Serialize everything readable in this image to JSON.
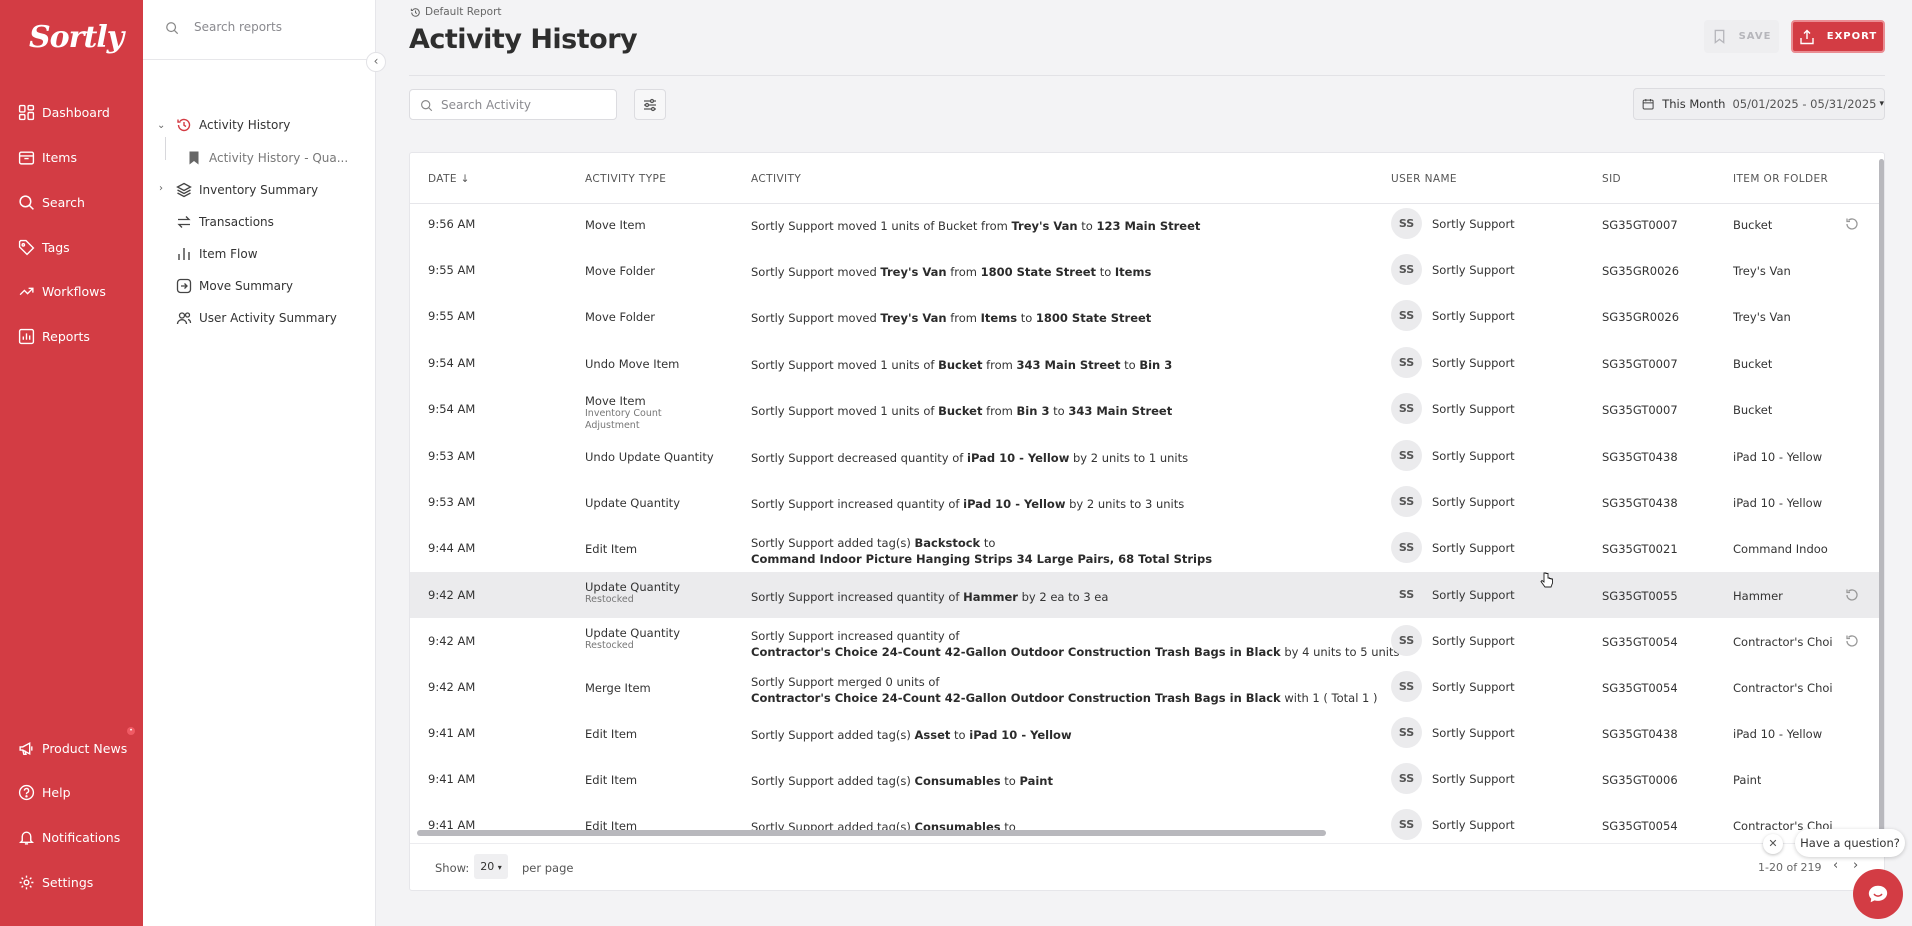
{
  "app": {
    "brand": "Sortly",
    "accent": "#d33c44"
  },
  "nav": {
    "items": [
      {
        "label": "Dashboard",
        "icon": "dashboard-icon"
      },
      {
        "label": "Items",
        "icon": "items-icon"
      },
      {
        "label": "Search",
        "icon": "search-icon"
      },
      {
        "label": "Tags",
        "icon": "tag-icon"
      },
      {
        "label": "Workflows",
        "icon": "workflows-icon"
      },
      {
        "label": "Reports",
        "icon": "reports-icon"
      }
    ],
    "bottom": [
      {
        "label": "Product News",
        "icon": "megaphone-icon"
      },
      {
        "label": "Help",
        "icon": "help-icon"
      },
      {
        "label": "Notifications",
        "icon": "bell-icon"
      },
      {
        "label": "Settings",
        "icon": "gear-icon"
      }
    ]
  },
  "reports_panel": {
    "search_placeholder": "Search reports",
    "tree": [
      {
        "label": "Activity History",
        "icon": "history-icon",
        "active": true
      },
      {
        "label": "Activity History - Qua...",
        "icon": "bookmark-icon",
        "child": true
      },
      {
        "label": "Inventory Summary",
        "icon": "layers-icon"
      },
      {
        "label": "Transactions",
        "icon": "transactions-icon"
      },
      {
        "label": "Item Flow",
        "icon": "bar-chart-icon"
      },
      {
        "label": "Move Summary",
        "icon": "move-icon"
      },
      {
        "label": "User Activity Summary",
        "icon": "users-icon"
      }
    ]
  },
  "header": {
    "breadcrumb": "Default Report",
    "title": "Activity History",
    "save_label": "SAVE",
    "export_label": "EXPORT"
  },
  "toolbar": {
    "search_placeholder": "Search Activity",
    "range_label": "This Month",
    "range_dates": "05/01/2025 - 05/31/2025"
  },
  "table": {
    "columns": [
      "DATE",
      "ACTIVITY TYPE",
      "ACTIVITY",
      "USER NAME",
      "SID",
      "ITEM OR FOLDER"
    ],
    "rows": [
      {
        "time": "9:56 AM",
        "type": "Move Item",
        "sub": "",
        "activity": [
          "Sortly Support moved 1 units of Bucket from ",
          {
            "b": "Trey's Van"
          },
          " to ",
          {
            "b": "123 Main Street"
          }
        ],
        "initials": "SS",
        "user": "Sortly Support",
        "sid": "SG35GT0007",
        "item": "Bucket",
        "restore": true
      },
      {
        "time": "9:55 AM",
        "type": "Move Folder",
        "sub": "",
        "activity": [
          "Sortly Support moved ",
          {
            "b": "Trey's Van"
          },
          " from ",
          {
            "b": "1800 State Street"
          },
          " to ",
          {
            "b": "Items"
          }
        ],
        "initials": "SS",
        "user": "Sortly Support",
        "sid": "SG35GR0026",
        "item": "Trey's Van",
        "restore": false
      },
      {
        "time": "9:55 AM",
        "type": "Move Folder",
        "sub": "",
        "activity": [
          "Sortly Support moved ",
          {
            "b": "Trey's Van"
          },
          " from ",
          {
            "b": "Items"
          },
          " to ",
          {
            "b": "1800 State Street"
          }
        ],
        "initials": "SS",
        "user": "Sortly Support",
        "sid": "SG35GR0026",
        "item": "Trey's Van",
        "restore": false
      },
      {
        "time": "9:54 AM",
        "type": "Undo Move Item",
        "sub": "",
        "activity": [
          "Sortly Support moved 1 units of ",
          {
            "b": "Bucket"
          },
          " from ",
          {
            "b": "343 Main Street"
          },
          " to ",
          {
            "b": "Bin 3"
          }
        ],
        "initials": "SS",
        "user": "Sortly Support",
        "sid": "SG35GT0007",
        "item": "Bucket",
        "restore": false
      },
      {
        "time": "9:54 AM",
        "type": "Move Item",
        "sub": "Inventory Count Adjustment",
        "activity": [
          "Sortly Support moved 1 units of ",
          {
            "b": "Bucket"
          },
          " from ",
          {
            "b": "Bin 3"
          },
          " to ",
          {
            "b": "343 Main Street"
          }
        ],
        "initials": "SS",
        "user": "Sortly Support",
        "sid": "SG35GT0007",
        "item": "Bucket",
        "restore": false
      },
      {
        "time": "9:53 AM",
        "type": "Undo Update Quantity",
        "sub": "",
        "activity": [
          "Sortly Support decreased quantity of ",
          {
            "b": "iPad 10 - Yellow"
          },
          " by 2 units to 1 units"
        ],
        "initials": "SS",
        "user": "Sortly Support",
        "sid": "SG35GT0438",
        "item": "iPad 10 - Yellow",
        "restore": false
      },
      {
        "time": "9:53 AM",
        "type": "Update Quantity",
        "sub": "",
        "activity": [
          "Sortly Support increased quantity of ",
          {
            "b": "iPad 10 - Yellow"
          },
          " by 2 units to 3 units"
        ],
        "initials": "SS",
        "user": "Sortly Support",
        "sid": "SG35GT0438",
        "item": "iPad 10 - Yellow",
        "restore": false
      },
      {
        "time": "9:44 AM",
        "type": "Edit Item",
        "sub": "",
        "activity": [
          "Sortly Support added tag(s) ",
          {
            "b": "Backstock"
          },
          " to"
        ],
        "activity2": [
          {
            "b": "Command Indoor Picture Hanging Strips 34 Large Pairs, 68 Total Strips"
          }
        ],
        "initials": "SS",
        "user": "Sortly Support",
        "sid": "SG35GT0021",
        "item": "Command Indoo",
        "restore": false
      },
      {
        "time": "9:42 AM",
        "type": "Update Quantity",
        "sub": "Restocked",
        "activity": [
          "Sortly Support increased quantity of ",
          {
            "b": "Hammer"
          },
          " by 2 ea to 3 ea"
        ],
        "initials": "SS",
        "user": "Sortly Support",
        "sid": "SG35GT0055",
        "item": "Hammer",
        "restore": true,
        "highlight": true
      },
      {
        "time": "9:42 AM",
        "type": "Update Quantity",
        "sub": "Restocked",
        "activity": [
          "Sortly Support increased quantity of"
        ],
        "activity2": [
          {
            "b": "Contractor's Choice 24-Count 42-Gallon Outdoor Construction Trash Bags in Black"
          },
          " by 4 units to 5 units"
        ],
        "initials": "SS",
        "user": "Sortly Support",
        "sid": "SG35GT0054",
        "item": "Contractor's Choi",
        "restore": true
      },
      {
        "time": "9:42 AM",
        "type": "Merge Item",
        "sub": "",
        "activity": [
          "Sortly Support merged 0 units of"
        ],
        "activity2": [
          {
            "b": "Contractor's Choice 24-Count 42-Gallon Outdoor Construction Trash Bags in Black"
          },
          " with 1 ( Total 1 )"
        ],
        "initials": "SS",
        "user": "Sortly Support",
        "sid": "SG35GT0054",
        "item": "Contractor's Choi",
        "restore": false
      },
      {
        "time": "9:41 AM",
        "type": "Edit Item",
        "sub": "",
        "activity": [
          "Sortly Support added tag(s) ",
          {
            "b": "Asset"
          },
          " to ",
          {
            "b": "iPad 10 - Yellow"
          }
        ],
        "initials": "SS",
        "user": "Sortly Support",
        "sid": "SG35GT0438",
        "item": "iPad 10 - Yellow",
        "restore": false
      },
      {
        "time": "9:41 AM",
        "type": "Edit Item",
        "sub": "",
        "activity": [
          "Sortly Support added tag(s) ",
          {
            "b": "Consumables"
          },
          " to ",
          {
            "b": "Paint"
          }
        ],
        "initials": "SS",
        "user": "Sortly Support",
        "sid": "SG35GT0006",
        "item": "Paint",
        "restore": false
      },
      {
        "time": "9:41 AM",
        "type": "Edit Item",
        "sub": "",
        "activity": [
          "Sortly Support added tag(s) ",
          {
            "b": "Consumables"
          },
          " to"
        ],
        "initials": "SS",
        "user": "Sortly Support",
        "sid": "SG35GT0054",
        "item": "Contractor's Choi",
        "restore": false
      }
    ]
  },
  "footer": {
    "show_label": "Show:",
    "per_page": "20",
    "per_page_label": "per page",
    "range": "1-20 of 219"
  },
  "chat": {
    "prompt": "Have a question?"
  }
}
